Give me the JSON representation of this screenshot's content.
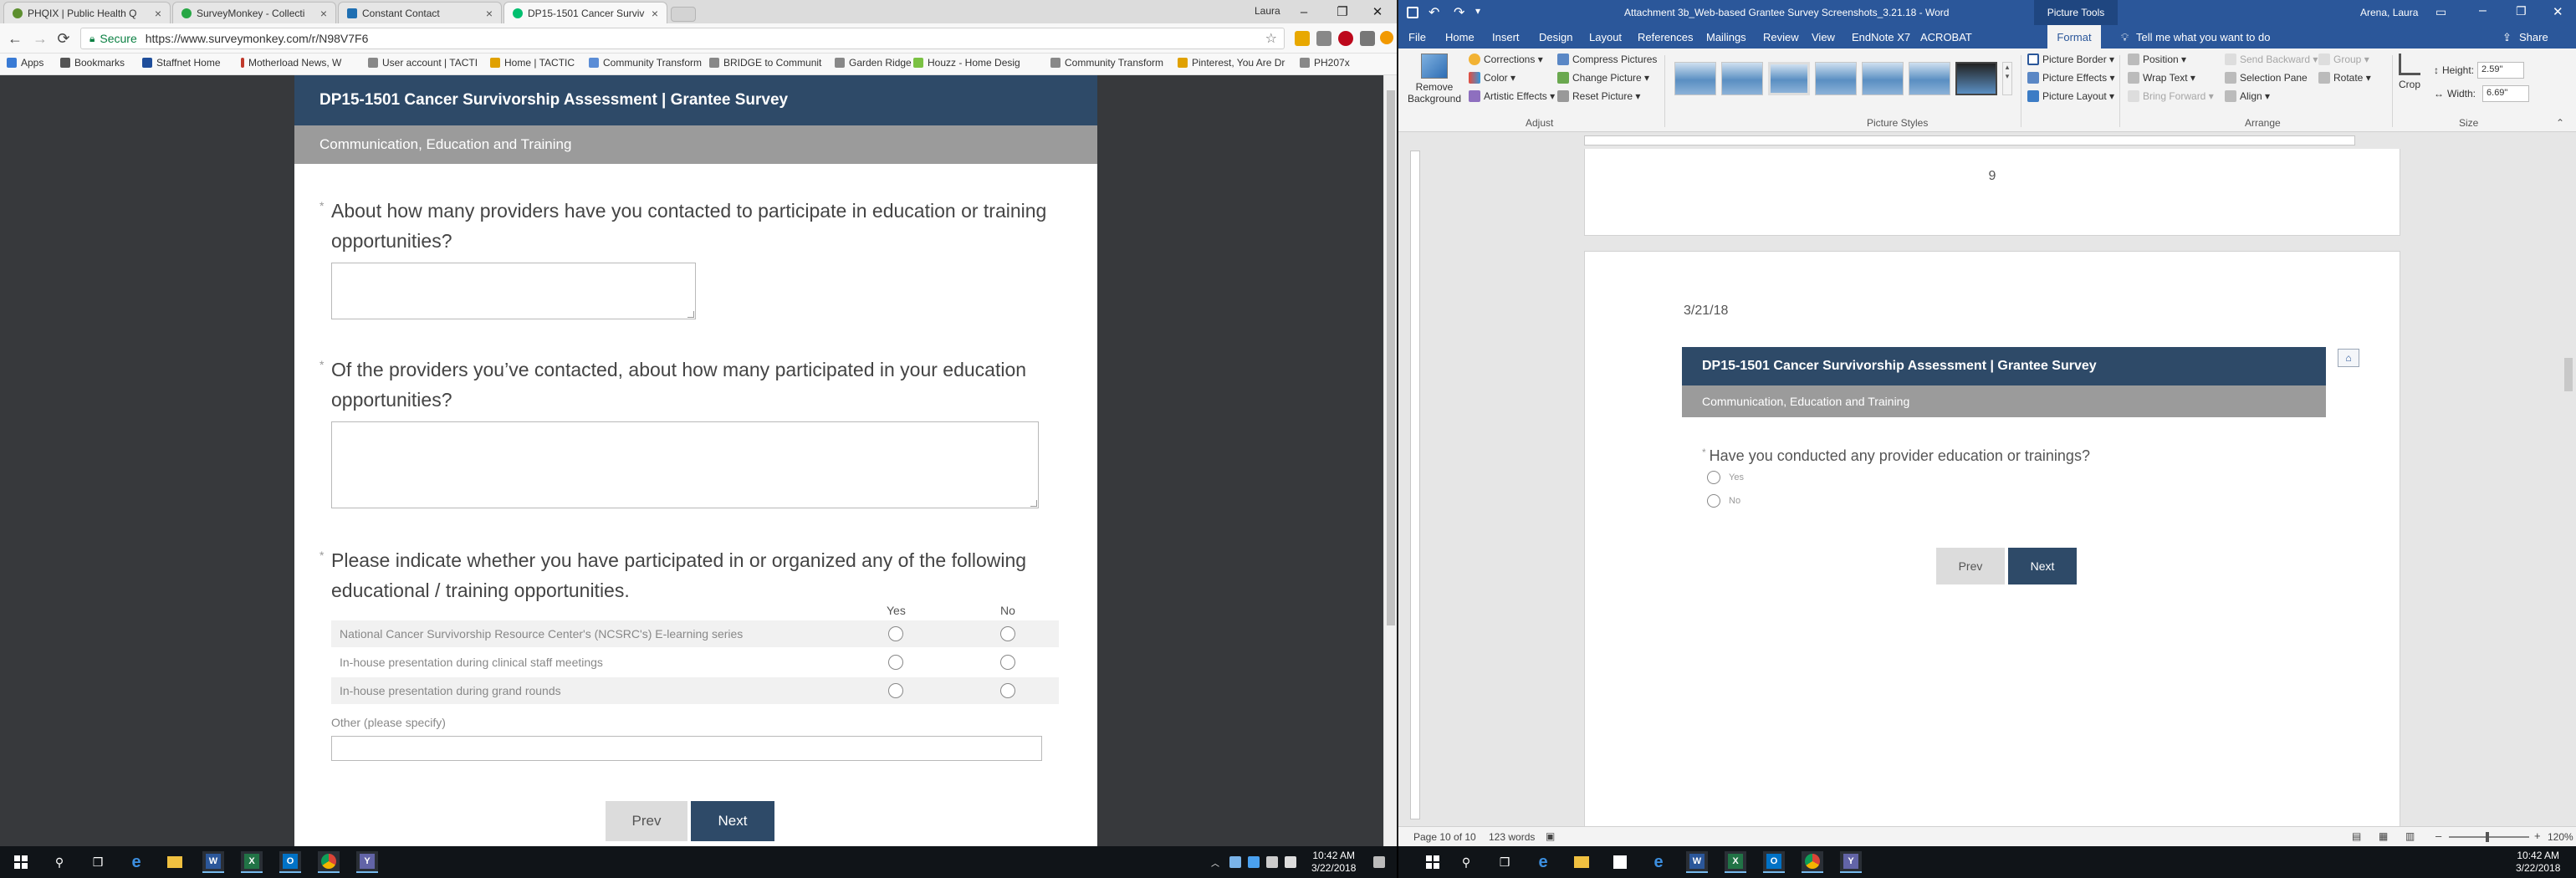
{
  "chrome": {
    "tabs": [
      {
        "label": "PHQIX | Public Health Q",
        "color": "#5d8f2f"
      },
      {
        "label": "SurveyMonkey - Collecti",
        "color": "#28a745"
      },
      {
        "label": "Constant Contact",
        "color": "#1f6fb2"
      },
      {
        "label": "DP15-1501 Cancer Surviv",
        "color": "#00bf6f"
      }
    ],
    "user": "Laura",
    "secure_label": "Secure",
    "url": "https://www.surveymonkey.com/r/N98V7F6",
    "bookmarks": [
      {
        "label": "Apps",
        "color": "#3a7bd5"
      },
      {
        "label": "Bookmarks",
        "color": "#555555"
      },
      {
        "label": "Staffnet Home",
        "color": "#1f4e9b"
      },
      {
        "label": "Motherload News, W",
        "color": "#c0392b"
      },
      {
        "label": "User account | TACTI",
        "color": "#888888"
      },
      {
        "label": "Home | TACTIC",
        "color": "#e0a100"
      },
      {
        "label": "Community Transform",
        "color": "#5b8dd6"
      },
      {
        "label": "BRIDGE to Communit",
        "color": "#888888"
      },
      {
        "label": "Garden Ridge",
        "color": "#888888"
      },
      {
        "label": "Houzz - Home Desig",
        "color": "#7ac142"
      },
      {
        "label": "Community Transform",
        "color": "#888888"
      },
      {
        "label": "Pinterest, You Are Dr",
        "color": "#e0a100"
      },
      {
        "label": "PH207x",
        "color": "#888888"
      }
    ]
  },
  "survey": {
    "title": "DP15-1501 Cancer Survivorship Assessment | Grantee Survey",
    "section": "Communication, Education and Training",
    "q1": "About how many providers have you contacted to participate in education or training opportunities?",
    "q2": "Of the providers you’ve contacted, about how many participated in your education opportunities?",
    "q3": "Please indicate whether you have participated in or organized any of the following educational / training opportunities.",
    "col_yes": "Yes",
    "col_no": "No",
    "rows": [
      "National Cancer Survivorship Resource Center's (NCSRC's) E-learning series",
      "In-house presentation during clinical staff meetings",
      "In-house presentation during grand rounds"
    ],
    "other_label": "Other (please specify)",
    "prev": "Prev",
    "next": "Next"
  },
  "word": {
    "title": "Attachment 3b_Web-based Grantee Survey Screenshots_3.21.18 - Word",
    "picture_tools": "Picture Tools",
    "user": "Arena, Laura",
    "share": "Share",
    "tabs": [
      "File",
      "Home",
      "Insert",
      "Design",
      "Layout",
      "References",
      "Mailings",
      "Review",
      "View",
      "EndNote X7",
      "ACROBAT"
    ],
    "active_tab": "Format",
    "tell_me": "Tell me what you want to do",
    "ribbon": {
      "remove_bg": "Remove Background",
      "corrections": "Corrections",
      "color": "Color",
      "artistic": "Artistic Effects",
      "compress": "Compress Pictures",
      "change": "Change Picture",
      "reset": "Reset Picture",
      "adjust": "Adjust",
      "styles": "Picture Styles",
      "border": "Picture Border",
      "effects": "Picture Effects",
      "layout": "Picture Layout",
      "position": "Position",
      "wrap": "Wrap Text",
      "bring": "Bring Forward",
      "send": "Send Backward",
      "selection": "Selection Pane",
      "align": "Align",
      "group": "Group",
      "rotate": "Rotate",
      "arrange": "Arrange",
      "crop": "Crop",
      "height_label": "Height:",
      "height": "2.59\"",
      "width_label": "Width:",
      "width": "6.69\"",
      "size": "Size"
    },
    "page9_number": "9",
    "page10_date": "3/21/18",
    "pic": {
      "title": "DP15-1501 Cancer Survivorship Assessment | Grantee Survey",
      "section": "Communication, Education and Training",
      "question": "Have you conducted any provider education or trainings?",
      "yes": "Yes",
      "no": "No",
      "prev": "Prev",
      "next": "Next"
    },
    "status": {
      "page": "Page 10 of 10",
      "words": "123 words",
      "zoom": "120%"
    }
  },
  "taskbar": {
    "time": "10:42 AM",
    "date": "3/22/2018"
  }
}
